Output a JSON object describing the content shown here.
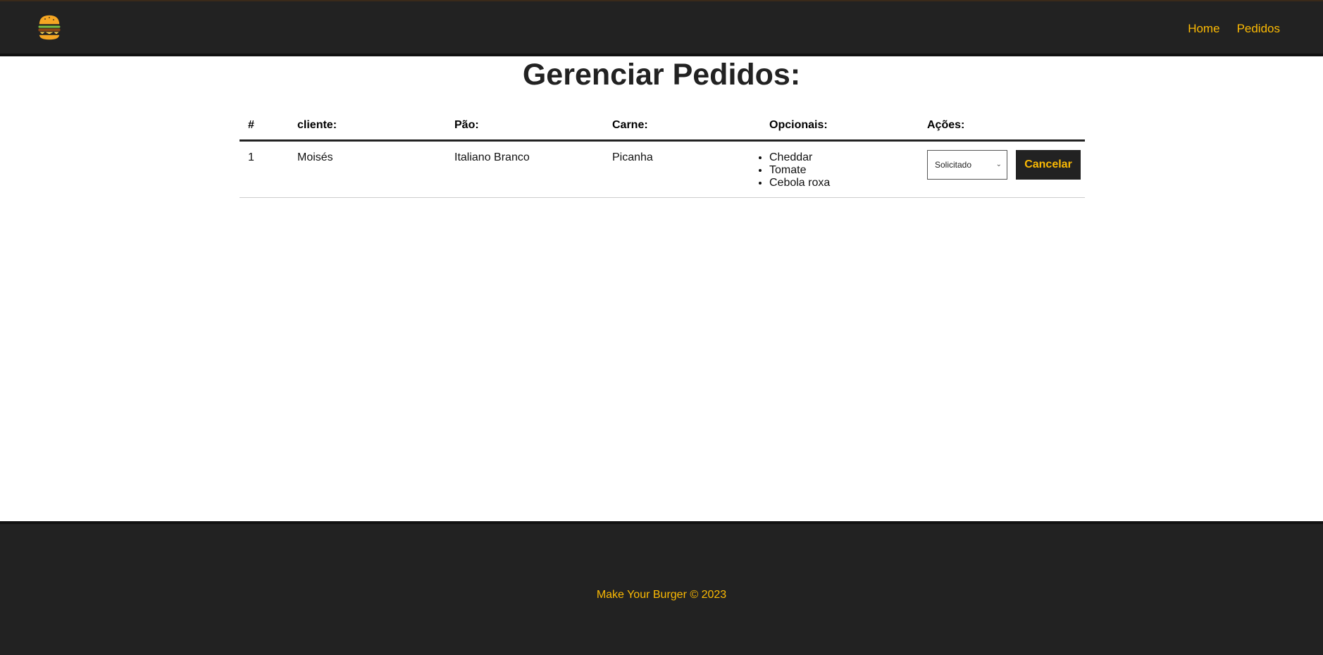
{
  "header": {
    "logo_icon": "burger-icon",
    "nav": [
      {
        "label": "Home"
      },
      {
        "label": "Pedidos"
      }
    ]
  },
  "page": {
    "title": "Gerenciar Pedidos:"
  },
  "table": {
    "headers": [
      "#",
      "cliente:",
      "Pão:",
      "Carne:",
      "Opcionais:",
      "Ações:"
    ],
    "rows": [
      {
        "id": "1",
        "cliente": "Moisés",
        "pao": "Italiano Branco",
        "carne": "Picanha",
        "opcionais": [
          "Cheddar",
          "Tomate",
          "Cebola roxa"
        ],
        "status": "Solicitado",
        "cancel_label": "Cancelar"
      }
    ]
  },
  "footer": {
    "text": "Make Your Burger © 2023"
  },
  "colors": {
    "primary": "#222222",
    "accent": "#fcba03"
  }
}
